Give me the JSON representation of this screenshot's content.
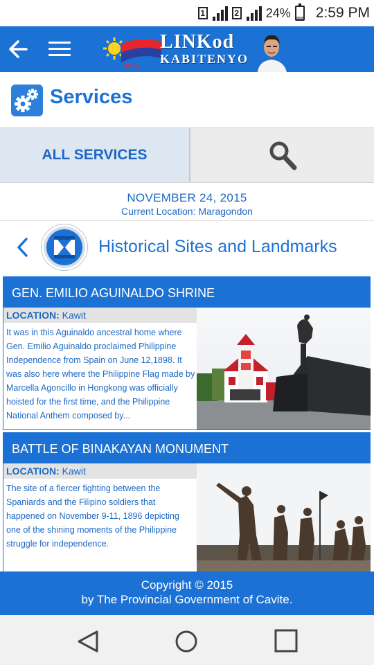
{
  "status": {
    "sim1": "1",
    "sim2": "2",
    "battery": "24%",
    "time": "2:59 PM",
    "battery_level": 0.24
  },
  "appbar": {
    "logo_main": "LINKod",
    "logo_sub": "KABITENYO",
    "back_icon": "arrow-left-icon",
    "menu_icon": "hamburger-menu-icon"
  },
  "services": {
    "title": "Services",
    "icon": "gears-icon"
  },
  "tabs": {
    "all_label": "ALL SERVICES",
    "search_icon": "search-icon"
  },
  "date_info": {
    "date": "NOVEMBER 24, 2015",
    "location": "Current Location: Maragondon"
  },
  "category": {
    "title": "Historical Sites and Landmarks",
    "icon": "hourglass-icon"
  },
  "sites": [
    {
      "name": "GEN. EMILIO AGUINALDO SHRINE",
      "location_label": "LOCATION:",
      "location": "Kawit",
      "description": "It was in this Aguinaldo ancestral home where Gen. Emilio Aguinaldo proclaimed Philippine Independence from Spain on June 12,1898. It was also here where the Philippine Flag made by Marcella Agoncillo in Hongkong was officially hoisted for the first time, and the Philippine National Anthem composed by..."
    },
    {
      "name": "BATTLE OF BINAKAYAN MONUMENT",
      "location_label": "LOCATION:",
      "location": "Kawit",
      "description": "The site of a fiercer fighting between the Spaniards and the Filipino soldiers that happened on November 9-11, 1896 depicting one of the shining moments of the Philippine struggle for independence."
    }
  ],
  "footer": {
    "line1": "Copyright © 2015",
    "line2": "by The Provincial Government of Cavite."
  },
  "nav": {
    "back": "nav-back-icon",
    "home": "nav-home-icon",
    "recents": "nav-recents-icon"
  }
}
